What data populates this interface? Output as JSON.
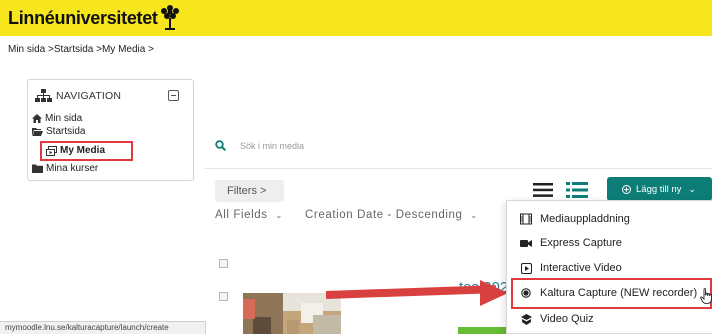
{
  "header": {
    "logo_text": "Linnéuniversitetet"
  },
  "breadcrumb": {
    "items": [
      "Min sida",
      "Startsida",
      "My Media"
    ],
    "separator": ">"
  },
  "navigation": {
    "title": "NAVIGATION",
    "items": [
      {
        "label": "Min sida",
        "icon": "home-icon"
      },
      {
        "label": "Startsida",
        "icon": "folder-open-icon"
      },
      {
        "label": "My Media",
        "icon": "media-icon",
        "highlighted": true
      },
      {
        "label": "Mina kurser",
        "icon": "folder-icon"
      }
    ]
  },
  "search": {
    "placeholder": "Sök i min media"
  },
  "filters": {
    "button_label": "Filters >",
    "fields_label": "All Fields",
    "sort_label": "Creation Date - Descending"
  },
  "add_button": {
    "label": "Lägg till ny"
  },
  "add_menu": {
    "items": [
      {
        "label": "Mediauppladdning",
        "icon": "film-icon"
      },
      {
        "label": "Express Capture",
        "icon": "video-camera-icon"
      },
      {
        "label": "Interactive Video",
        "icon": "play-box-icon"
      },
      {
        "label": "Kaltura Capture (NEW recorder)",
        "icon": "record-icon",
        "highlighted": true
      },
      {
        "label": "Video Quiz",
        "icon": "quiz-icon"
      }
    ]
  },
  "entry": {
    "title_partial": "tes 202"
  },
  "status_bar": {
    "url": "mymoodle.lnu.se/kalturacapture/launch/create"
  },
  "colors": {
    "brand_yellow": "#f7e51d",
    "accent_teal": "#0d7e77",
    "highlight_red": "#e0393e",
    "link_blue": "#2e7b8f"
  }
}
